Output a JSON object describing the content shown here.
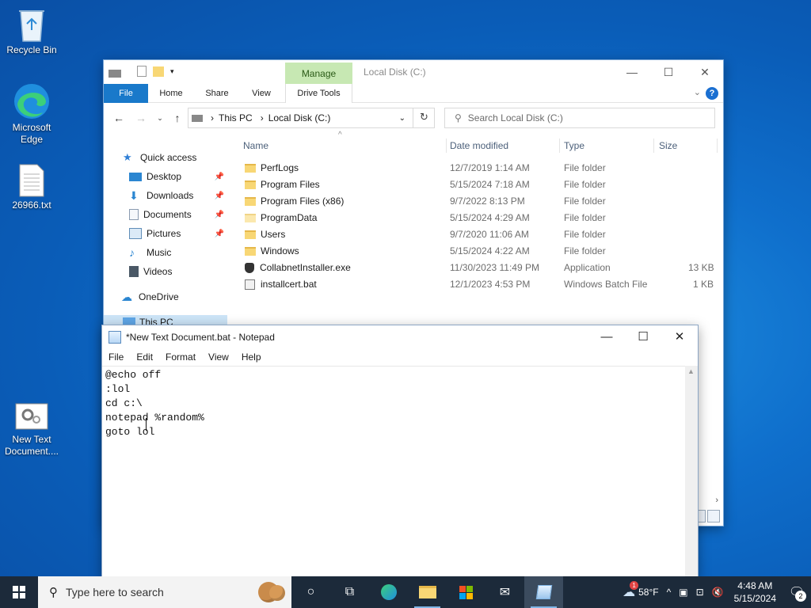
{
  "desktop": {
    "icons": [
      {
        "label": "Recycle Bin",
        "icon": "recycle-bin-icon"
      },
      {
        "label": "Microsoft Edge",
        "icon": "edge-icon"
      },
      {
        "label": "26966.txt",
        "icon": "text-file-icon"
      },
      {
        "label": "New Text Document....",
        "icon": "bat-file-icon"
      }
    ]
  },
  "explorer": {
    "title": "Local Disk (C:)",
    "context_tab": "Manage",
    "ribbon_tabs": [
      "File",
      "Home",
      "Share",
      "View",
      "Drive Tools"
    ],
    "address": {
      "root": "This PC",
      "current": "Local Disk (C:)"
    },
    "search_placeholder": "Search Local Disk (C:)",
    "nav": {
      "quick_access": "Quick access",
      "items": [
        "Desktop",
        "Downloads",
        "Documents",
        "Pictures",
        "Music",
        "Videos"
      ],
      "onedrive": "OneDrive",
      "this_pc": "This PC"
    },
    "columns": {
      "name": "Name",
      "date": "Date modified",
      "type": "Type",
      "size": "Size"
    },
    "files": [
      {
        "name": "PerfLogs",
        "date": "12/7/2019 1:14 AM",
        "type": "File folder",
        "size": "",
        "kind": "folder"
      },
      {
        "name": "Program Files",
        "date": "5/15/2024 7:18 AM",
        "type": "File folder",
        "size": "",
        "kind": "folder"
      },
      {
        "name": "Program Files (x86)",
        "date": "9/7/2022 8:13 PM",
        "type": "File folder",
        "size": "",
        "kind": "folder"
      },
      {
        "name": "ProgramData",
        "date": "5/15/2024 4:29 AM",
        "type": "File folder",
        "size": "",
        "kind": "folder-hidden"
      },
      {
        "name": "Users",
        "date": "9/7/2020 11:06 AM",
        "type": "File folder",
        "size": "",
        "kind": "folder"
      },
      {
        "name": "Windows",
        "date": "5/15/2024 4:22 AM",
        "type": "File folder",
        "size": "",
        "kind": "folder"
      },
      {
        "name": "CollabnetInstaller.exe",
        "date": "11/30/2023 11:49 PM",
        "type": "Application",
        "size": "13 KB",
        "kind": "exe"
      },
      {
        "name": "installcert.bat",
        "date": "12/1/2023 4:53 PM",
        "type": "Windows Batch File",
        "size": "1 KB",
        "kind": "bat"
      }
    ]
  },
  "notepad": {
    "title": "*New Text Document.bat - Notepad",
    "menu": [
      "File",
      "Edit",
      "Format",
      "View",
      "Help"
    ],
    "lines": [
      "@echo off",
      ":lol",
      "cd c:\\",
      "notepad %random%",
      "goto lol"
    ]
  },
  "taskbar": {
    "search_placeholder": "Type here to search",
    "weather": "58°F",
    "weather_badge": "1",
    "time": "4:48 AM",
    "date": "5/15/2024",
    "notification_count": "2"
  }
}
